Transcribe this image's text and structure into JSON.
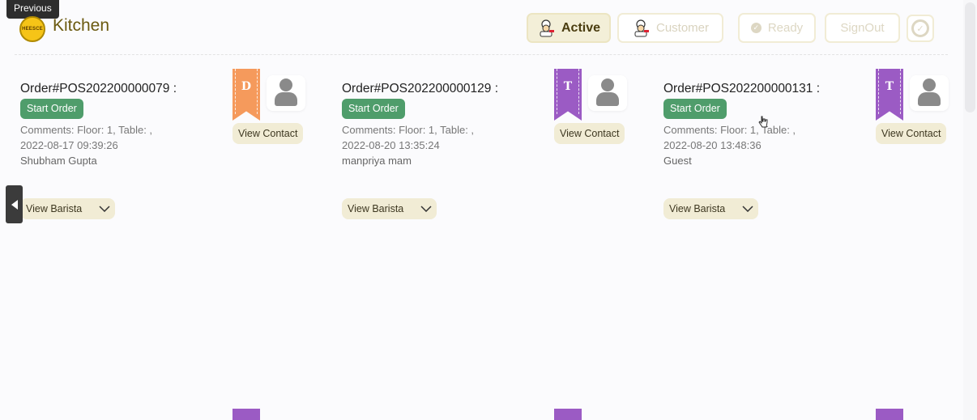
{
  "tooltip": "Previous",
  "header": {
    "logo_text": "HEESCE",
    "title": "Kitchen",
    "tabs": {
      "active": "Active",
      "customer": "Customer"
    },
    "ready_label": "Ready",
    "signout_label": "SignOut",
    "refresh_icon": "refresh-icon"
  },
  "orders": [
    {
      "order_no": "Order#POS202200000079 :",
      "start_label": "Start Order",
      "comments": "Comments: Floor: 1, Table: ,",
      "datetime": "2022-08-17 09:39:26",
      "customer": "Shubham Gupta",
      "badge": "D",
      "badge_color": "#f59a5c",
      "view_contact": "View Contact",
      "view_barista": "View Barista"
    },
    {
      "order_no": "Order#POS202200000129 :",
      "start_label": "Start Order",
      "comments": "Comments: Floor: 1, Table: ,",
      "datetime": "2022-08-20 13:35:24",
      "customer": "manpriya mam",
      "badge": "T",
      "badge_color": "#9b5bc4",
      "view_contact": "View Contact",
      "view_barista": "View Barista"
    },
    {
      "order_no": "Order#POS202200000131 :",
      "start_label": "Start Order",
      "comments": "Comments: Floor: 1, Table: ,",
      "datetime": "2022-08-20 13:48:36",
      "customer": "Guest",
      "badge": "T",
      "badge_color": "#9b5bc4",
      "view_contact": "View Contact",
      "view_barista": "View Barista"
    }
  ],
  "colors": {
    "accent": "#f1ecd5",
    "start_button": "#4f9d6b",
    "title": "#6b5a10"
  }
}
